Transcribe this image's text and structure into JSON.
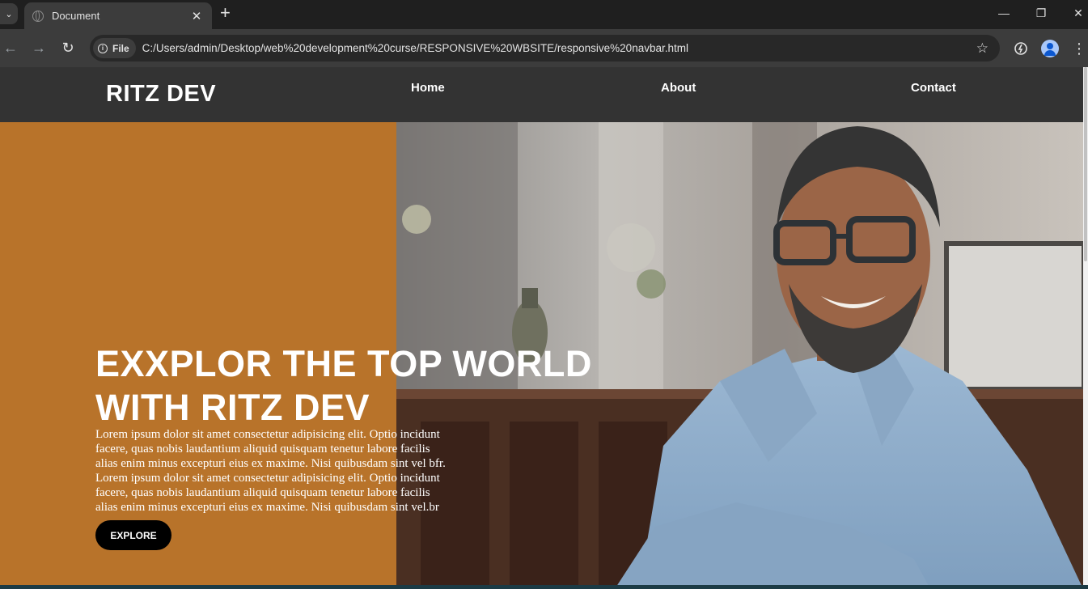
{
  "browser": {
    "tab_title": "Document",
    "tab_close": "✕",
    "new_tab": "+",
    "address_chip": "File",
    "url": "C:/Users/admin/Desktop/web%20development%20curse/RESPONSIVE%20WBSITE/responsive%20navbar.html"
  },
  "site": {
    "logo": "RITZ DEV",
    "nav": [
      "Home",
      "About",
      "Contact"
    ],
    "hero": {
      "title_line1": "EXXPLOR THE TOP WORLD",
      "title_line2": "WITH RITZ DEV",
      "body_line1": "Lorem ipsum dolor sit amet consectetur adipisicing elit. Optio incidunt",
      "body_line2": "facere, quas nobis laudantium aliquid quisquam tenetur labore facilis",
      "body_line3": "alias enim minus excepturi eius ex maxime. Nisi quibusdam sint vel bfr.",
      "body_line4": "Lorem ipsum dolor sit amet consectetur adipisicing elit. Optio incidunt",
      "body_line5": "facere, quas nobis laudantium aliquid quisquam tenetur labore facilis",
      "body_line6": "alias enim minus excepturi eius ex maxime. Nisi quibusdam sint vel.br",
      "button": "EXPLORE"
    }
  },
  "colors": {
    "accent": "#b8732a",
    "nav_bg": "#333333",
    "button_bg": "#000000"
  }
}
